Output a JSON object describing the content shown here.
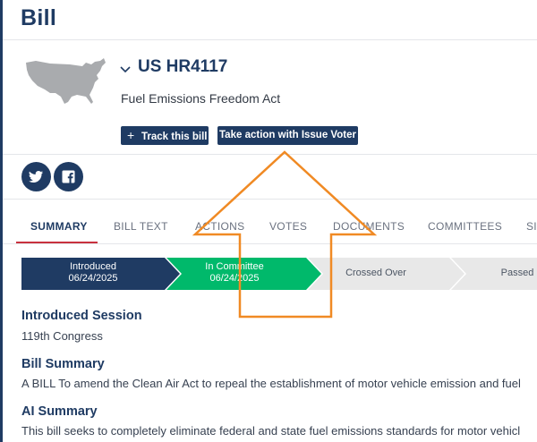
{
  "page": {
    "title": "Bill"
  },
  "bill": {
    "id": "US HR4117",
    "name": "Fuel Emissions Freedom Act"
  },
  "buttons": {
    "track": "Track this bill",
    "action": "Take action with Issue Voter"
  },
  "social": [
    "twitter-icon",
    "facebook-icon"
  ],
  "tabs": [
    {
      "label": "SUMMARY",
      "active": true
    },
    {
      "label": "BILL TEXT"
    },
    {
      "label": "ACTIONS"
    },
    {
      "label": "VOTES"
    },
    {
      "label": "DOCUMENTS"
    },
    {
      "label": "COMMITTEES"
    },
    {
      "label": "SI"
    }
  ],
  "progress": [
    {
      "label": "Introduced",
      "date": "06/24/2025",
      "status": "complete"
    },
    {
      "label": "In Committee",
      "date": "06/24/2025",
      "status": "current"
    },
    {
      "label": "Crossed Over",
      "status": "pending"
    },
    {
      "label": "Passed",
      "status": "pending"
    }
  ],
  "sections": {
    "introduced_session": {
      "title": "Introduced Session",
      "text": "119th Congress"
    },
    "bill_summary": {
      "title": "Bill Summary",
      "text": "A BILL To amend the Clean Air Act to repeal the establishment of motor vehicle emission and fuel"
    },
    "ai_summary": {
      "title": "AI Summary",
      "text": "This bill seeks to completely eliminate federal and state fuel emissions standards for motor vehicl"
    }
  },
  "colors": {
    "navy": "#1f3b63",
    "green": "#00b96b",
    "gray_stage": "#e8e8e8",
    "tab_underline": "#c8313e",
    "annotation_arrow": "#f08a24"
  }
}
